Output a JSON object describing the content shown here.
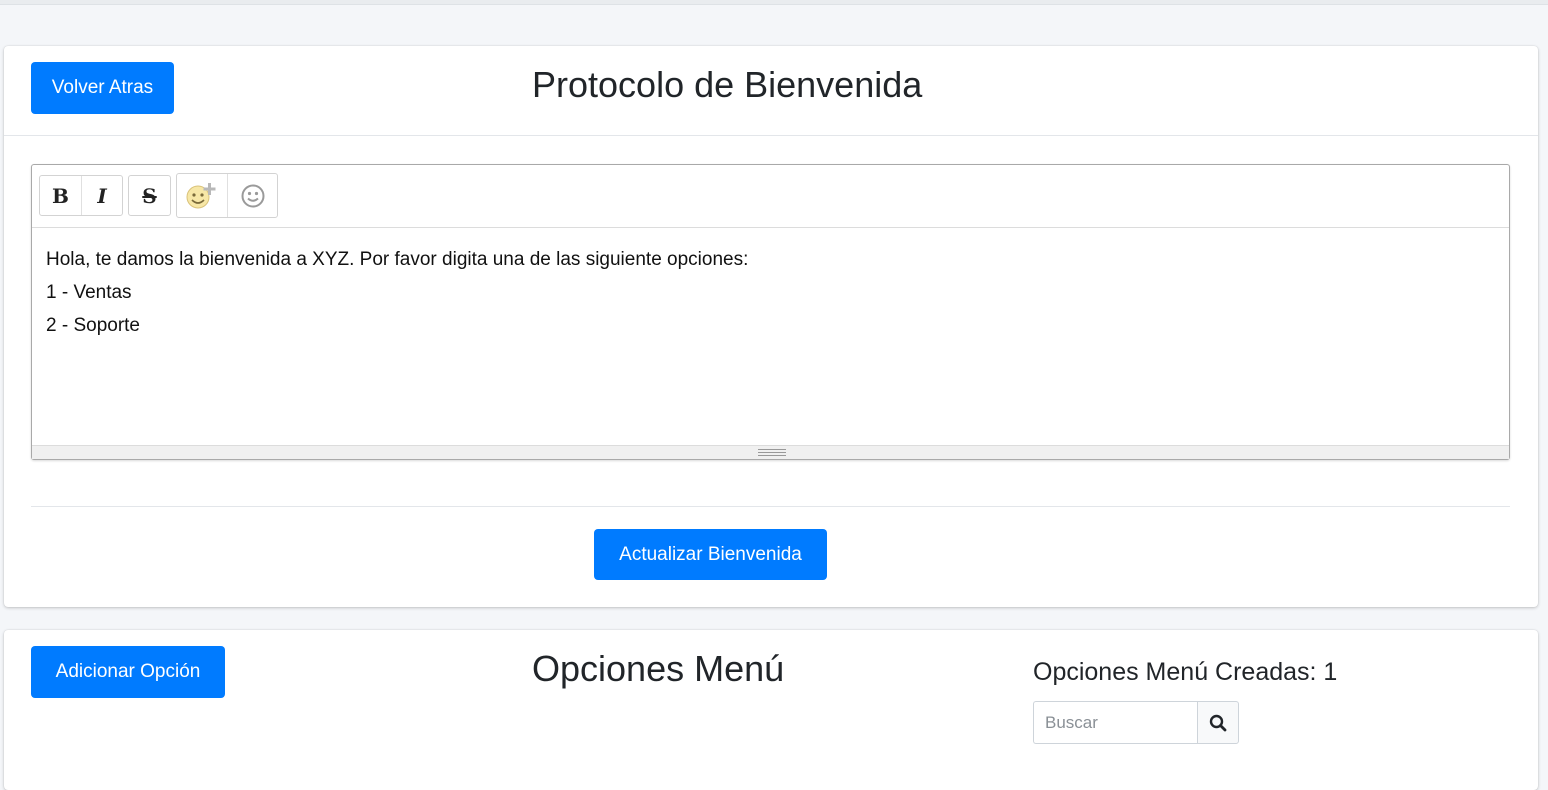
{
  "header": {
    "back_label": "Volver Atras",
    "title": "Protocolo de Bienvenida"
  },
  "editor": {
    "toolbar": {
      "bold": "B",
      "italic": "I",
      "strike": "S"
    },
    "content_lines": [
      "Hola, te damos la bienvenida a XYZ. Por favor digita una de las siguiente opciones:",
      "1 - Ventas",
      "2 - Soporte"
    ]
  },
  "update_label": "Actualizar Bienvenida",
  "menu": {
    "add_label": "Adicionar Opción",
    "title": "Opciones Menú",
    "count_label": "Opciones Menú Creadas: 1",
    "search_placeholder": "Buscar"
  },
  "icons": {
    "bold": "bold-icon",
    "italic": "italic-icon",
    "strike": "strikethrough-icon",
    "emoji_add": "emoji-add-icon",
    "emoji": "emoji-icon",
    "search": "search-icon"
  },
  "colors": {
    "primary": "#007bff",
    "background": "#f4f6f9"
  }
}
